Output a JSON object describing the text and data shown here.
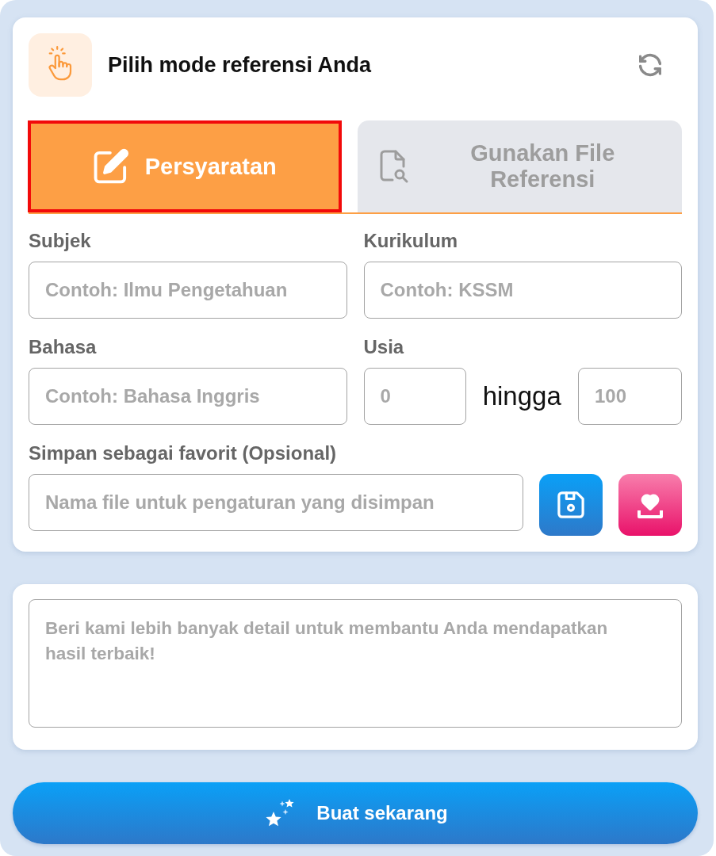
{
  "header": {
    "title": "Pilih mode referensi Anda"
  },
  "tabs": [
    {
      "label": "Persyaratan",
      "selected": true,
      "kind": "edit"
    },
    {
      "label": "Gunakan File Referensi",
      "selected": false,
      "kind": "file"
    }
  ],
  "fields": [
    {
      "kind": "text",
      "label": "Subjek",
      "placeholder": "Contoh: Ilmu Pengetahuan"
    },
    {
      "kind": "text",
      "label": "Kurikulum",
      "placeholder": "Contoh: KSSM"
    },
    {
      "kind": "text",
      "label": "Bahasa",
      "placeholder": "Contoh: Bahasa Inggris"
    },
    {
      "kind": "range",
      "label": "Usia",
      "from": {
        "placeholder": "0"
      },
      "separator": "hingga",
      "to": {
        "placeholder": "100"
      }
    }
  ],
  "favorite": {
    "label": "Simpan sebagai favorit (Opsional)",
    "placeholder": "Nama file untuk pengaturan yang disimpan"
  },
  "details": {
    "placeholder": "Beri kami lebih banyak detail untuk membantu Anda mendapatkan hasil terbaik!"
  },
  "generate_button": {
    "label": "Buat sekarang"
  }
}
